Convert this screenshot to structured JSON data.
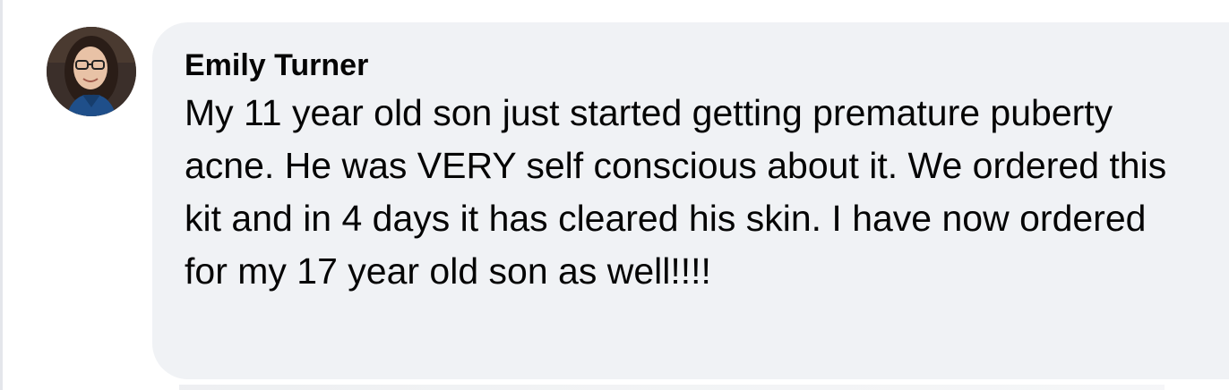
{
  "comment": {
    "author_name": "Emily Turner",
    "text": "My 11 year old son just started getting premature puberty acne. He was VERY self conscious about it. We ordered this kit and in 4 days it has cleared his skin. I have now ordered for my 17 year old son as well!!!!",
    "avatar_icon": "user-photo"
  },
  "colors": {
    "bubble_background": "#f0f2f5",
    "text": "#050505"
  }
}
